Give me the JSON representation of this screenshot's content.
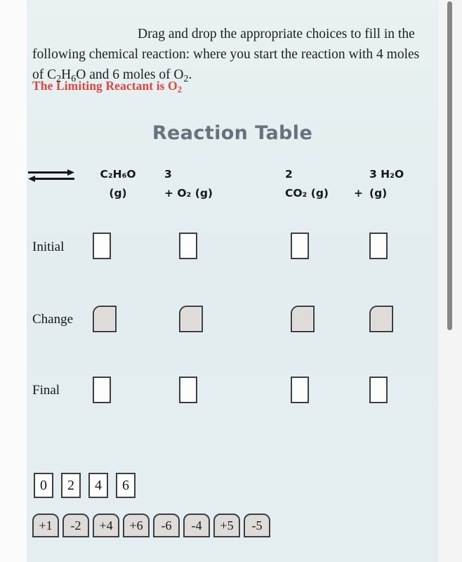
{
  "page": {
    "background_color": "#e4eef0",
    "accent_red": "#e0453f",
    "title_color": "#65737e"
  },
  "instructions": {
    "text_part1": "Drag and drop the appropriate choices to fill in the following chemical reaction: where you start the reaction with 4 moles of C",
    "sub1": "2",
    "text_part2": "H",
    "sub2": "6",
    "text_part3": "O and 6 moles of O",
    "sub3": "2",
    "text_part4": "."
  },
  "limiting_reactant": {
    "prefix": "The Limiting Reactant is O",
    "subscript": "2"
  },
  "table": {
    "title": "Reaction Table",
    "equation": {
      "reactant1": {
        "coefficient": "",
        "line1": "C₂H₆O",
        "line2": "(g)"
      },
      "plus1": "+",
      "reactant2": {
        "coefficient": "3",
        "line1": "3",
        "line2": "+  O₂ (g)"
      },
      "arrow": "equilibrium-arrow",
      "product1": {
        "coefficient": "2",
        "line1": "2",
        "line2": "CO₂ (g)"
      },
      "plus2": "+",
      "product2": {
        "coefficient": "3",
        "line1": "3 H₂O",
        "line2": "(g)"
      }
    },
    "rows": [
      {
        "label": "Initial",
        "type": "blank",
        "cells": [
          "",
          "",
          "",
          ""
        ]
      },
      {
        "label": "Change",
        "type": "change",
        "cells": [
          "",
          "",
          "",
          ""
        ]
      },
      {
        "label": "Final",
        "type": "blank",
        "cells": [
          "",
          "",
          "",
          ""
        ]
      }
    ]
  },
  "choices": {
    "numbers": [
      "0",
      "2",
      "4",
      "6"
    ],
    "deltas": [
      "+1",
      "-2",
      "+4",
      "+6",
      "-6",
      "-4",
      "+5",
      "-5"
    ]
  },
  "scrollbar": {
    "orientation": "vertical",
    "thumb_color": "#868686"
  }
}
